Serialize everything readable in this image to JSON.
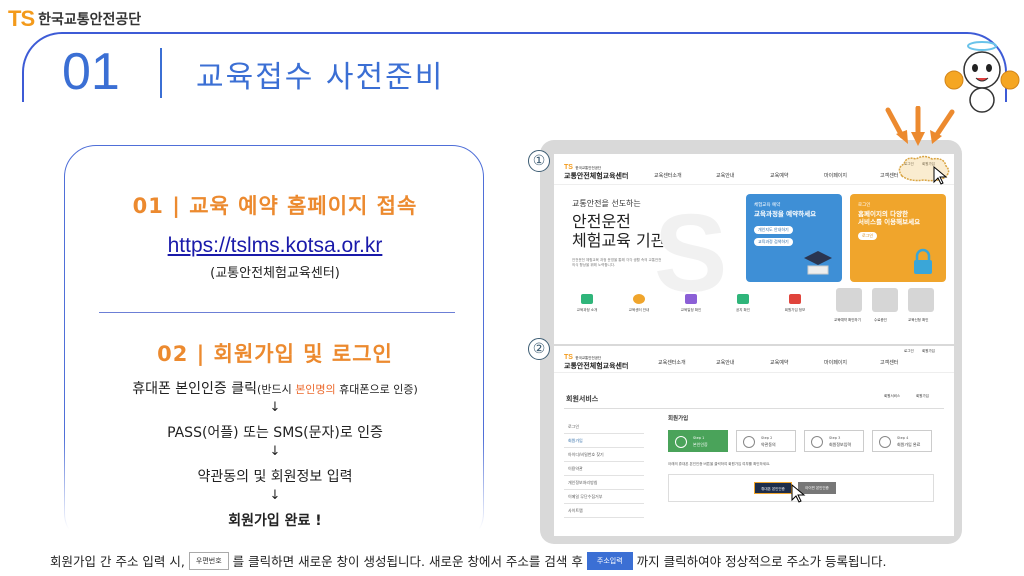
{
  "brand": {
    "ts": "TS",
    "name": "한국교통안전공단"
  },
  "header": {
    "number": "01",
    "title": "교육접수 사전준비"
  },
  "left": {
    "step1_title": "01  |  교육 예약 홈페이지 접속",
    "url": "https://tslms.kotsa.or.kr",
    "url_sub": "(교통안전체험교육센터)",
    "step2_title": "02  |  회원가입 및 로그인",
    "flow1_main": "휴대폰 본인인증 클릭",
    "flow1_paren_a": "(반드시 ",
    "flow1_paren_hl": "본인명의",
    "flow1_paren_b": " 휴대폰으로 인증)",
    "arrow": "↓",
    "flow2": "PASS(어플) 또는 SMS(문자)로 인증",
    "flow3": "약관동의 및 회원정보 입력",
    "flow4": "회원가입 완료 !"
  },
  "shot1": {
    "num": "①",
    "logo_sub": "한국교통안전공단",
    "logo_main": "교통안전체험교육센터",
    "nav": [
      "교육센터소개",
      "교육안내",
      "교육예약",
      "마이페이지",
      "고객센터"
    ],
    "top_links": [
      "로그인",
      "회원가입"
    ],
    "hero_small": "교통안전을 선도하는",
    "hero_line1": "안전운전",
    "hero_line2": "체험교육 기관",
    "hero_desc": "안전운전 체험교육 과정 운영을 통해 각각 생활 속의 교통안전의식 향상을 위해 노력합니다.",
    "card1_small": "체험교육 예약",
    "card1_title": "교육과정을 예약하세요",
    "card1_btn1": "개인지도 안내하기",
    "card1_btn2": "교육과정 검색하기",
    "card2_small": "로그인",
    "card2_title1": "홈페이지의 다양한",
    "card2_title2": "서비스를 이용해보세요",
    "card2_btn": "로그인",
    "icons": [
      "교육과정 소개",
      "교육센터 안내",
      "교육일정 확인",
      "공지 확인",
      "회원가입 정보",
      "교육예약 확인하기",
      "수료증인",
      "교육신청 확인"
    ],
    "colors": {
      "card1": "#3e8fd6",
      "card2": "#f0a52c",
      "icon_green": "#2fb57a",
      "icon_orange": "#f0a52c",
      "icon_purple": "#8b5fd6",
      "icon_red": "#e0443c"
    }
  },
  "shot2": {
    "num": "②",
    "logo_sub": "한국교통안전공단",
    "logo_main": "교통안전체험교육센터",
    "nav": [
      "교육센터소개",
      "교육안내",
      "교육예약",
      "마이페이지",
      "고객센터"
    ],
    "top_links": [
      "로그인",
      "회원가입"
    ],
    "section_title": "회원서비스",
    "breadcrumb": [
      "회원서비스",
      "회원가입"
    ],
    "side_menu": [
      "로그인",
      "회원가입",
      "아이디/비밀번호 찾기",
      "이용약관",
      "개인정보처리방침",
      "이메일 무단수집거부",
      "사이트맵"
    ],
    "page_title": "회원가입",
    "steps": [
      {
        "s": "Step 1",
        "label": "본인인증"
      },
      {
        "s": "Step 2",
        "label": "약관동의"
      },
      {
        "s": "Step 3",
        "label": "회원정보입력"
      },
      {
        "s": "Step 4",
        "label": "회원가입 완료"
      }
    ],
    "notice": "아래의 휴대폰 본인인증 버튼을 클릭하여 회원가입 여부를 확인하세요.",
    "btn_phone": "휴대폰 본인인증",
    "btn_other": "아이핀 본인인증",
    "colors": {
      "step_active": "#4aa35a",
      "btn_dark": "#1e2d4a"
    }
  },
  "bottom": {
    "part1": "회원가입 간 주소 입력 시,",
    "box_label": "우편번호",
    "part2": "를 클릭하면 새로운 창이 생성됩니다. 새로운 창에서 주소를 검색 후",
    "btn_label": "주소입력",
    "part3": "까지 클릭하여야 정상적으로 주소가 등록됩니다."
  },
  "colors": {
    "accent_blue": "#3b6fd4",
    "accent_orange": "#ec8a2f",
    "panel_grey": "#d9d9d9"
  }
}
